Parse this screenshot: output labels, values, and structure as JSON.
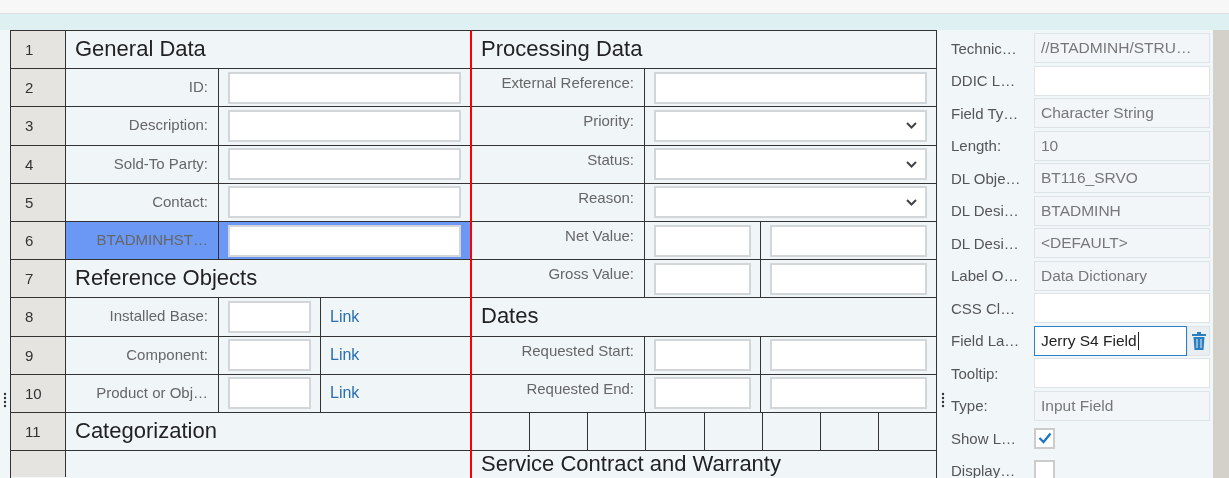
{
  "left_rows": [
    {
      "number": "1",
      "kind": "heading",
      "text": "General Data",
      "selected": false
    },
    {
      "number": "2",
      "kind": "input",
      "label": "ID:",
      "selected": false
    },
    {
      "number": "3",
      "kind": "input",
      "label": "Description:",
      "selected": false
    },
    {
      "number": "4",
      "kind": "input",
      "label": "Sold-To Party:",
      "selected": false
    },
    {
      "number": "5",
      "kind": "input",
      "label": "Contact:",
      "selected": false
    },
    {
      "number": "6",
      "kind": "input",
      "label": "BTADMINHST…",
      "selected": true
    },
    {
      "number": "7",
      "kind": "heading",
      "text": "Reference Objects",
      "selected": false
    },
    {
      "number": "8",
      "kind": "link",
      "label": "Installed Base:",
      "link": "Link",
      "selected": false
    },
    {
      "number": "9",
      "kind": "link",
      "label": "Component:",
      "link": "Link",
      "selected": false
    },
    {
      "number": "10",
      "kind": "link",
      "label": "Product or Obj…",
      "link": "Link",
      "selected": false
    },
    {
      "number": "11",
      "kind": "heading",
      "text": "Categorization",
      "selected": false
    },
    {
      "kind": "empty",
      "selected": false
    }
  ],
  "middle_rows": [
    {
      "kind": "heading",
      "text": "Processing Data"
    },
    {
      "kind": "input",
      "label": "External Reference:"
    },
    {
      "kind": "select",
      "label": "Priority:"
    },
    {
      "kind": "select",
      "label": "Status:"
    },
    {
      "kind": "select",
      "label": "Reason:"
    },
    {
      "kind": "split",
      "label": "Net Value:"
    },
    {
      "kind": "split",
      "label": "Gross Value:"
    },
    {
      "kind": "heading",
      "text": "Dates"
    },
    {
      "kind": "split",
      "label": "Requested Start:"
    },
    {
      "kind": "split",
      "label": "Requested End:"
    },
    {
      "kind": "grid"
    },
    {
      "kind": "heading",
      "text": "Service Contract and Warranty"
    }
  ],
  "properties": [
    {
      "label": "Technic…",
      "kind": "readonly",
      "value": "//BTADMINH/STRU…"
    },
    {
      "label": "DDIC L…",
      "kind": "input"
    },
    {
      "label": "Field Ty…",
      "kind": "readonly",
      "value": "Character String"
    },
    {
      "label": "Length:",
      "kind": "readonly",
      "value": "10"
    },
    {
      "label": "DL Obje…",
      "kind": "readonly",
      "value": "BT116_SRVO"
    },
    {
      "label": "DL Desi…",
      "kind": "readonly",
      "value": "BTADMINH"
    },
    {
      "label": "DL Desi…",
      "kind": "readonly",
      "value": "<DEFAULT>"
    },
    {
      "label": "Label O…",
      "kind": "readonly",
      "value": "Data Dictionary"
    },
    {
      "label": "CSS Cl…",
      "kind": "input"
    },
    {
      "label": "Field La…",
      "kind": "focused",
      "value": "Jerry S4 Field"
    },
    {
      "label": "Tooltip:",
      "kind": "input"
    },
    {
      "label": "Type:",
      "kind": "readonly",
      "value": "Input Field"
    },
    {
      "label": "Show L…",
      "kind": "checkbox",
      "checked": true
    },
    {
      "label": "Display…",
      "kind": "checkbox",
      "checked": false
    }
  ]
}
